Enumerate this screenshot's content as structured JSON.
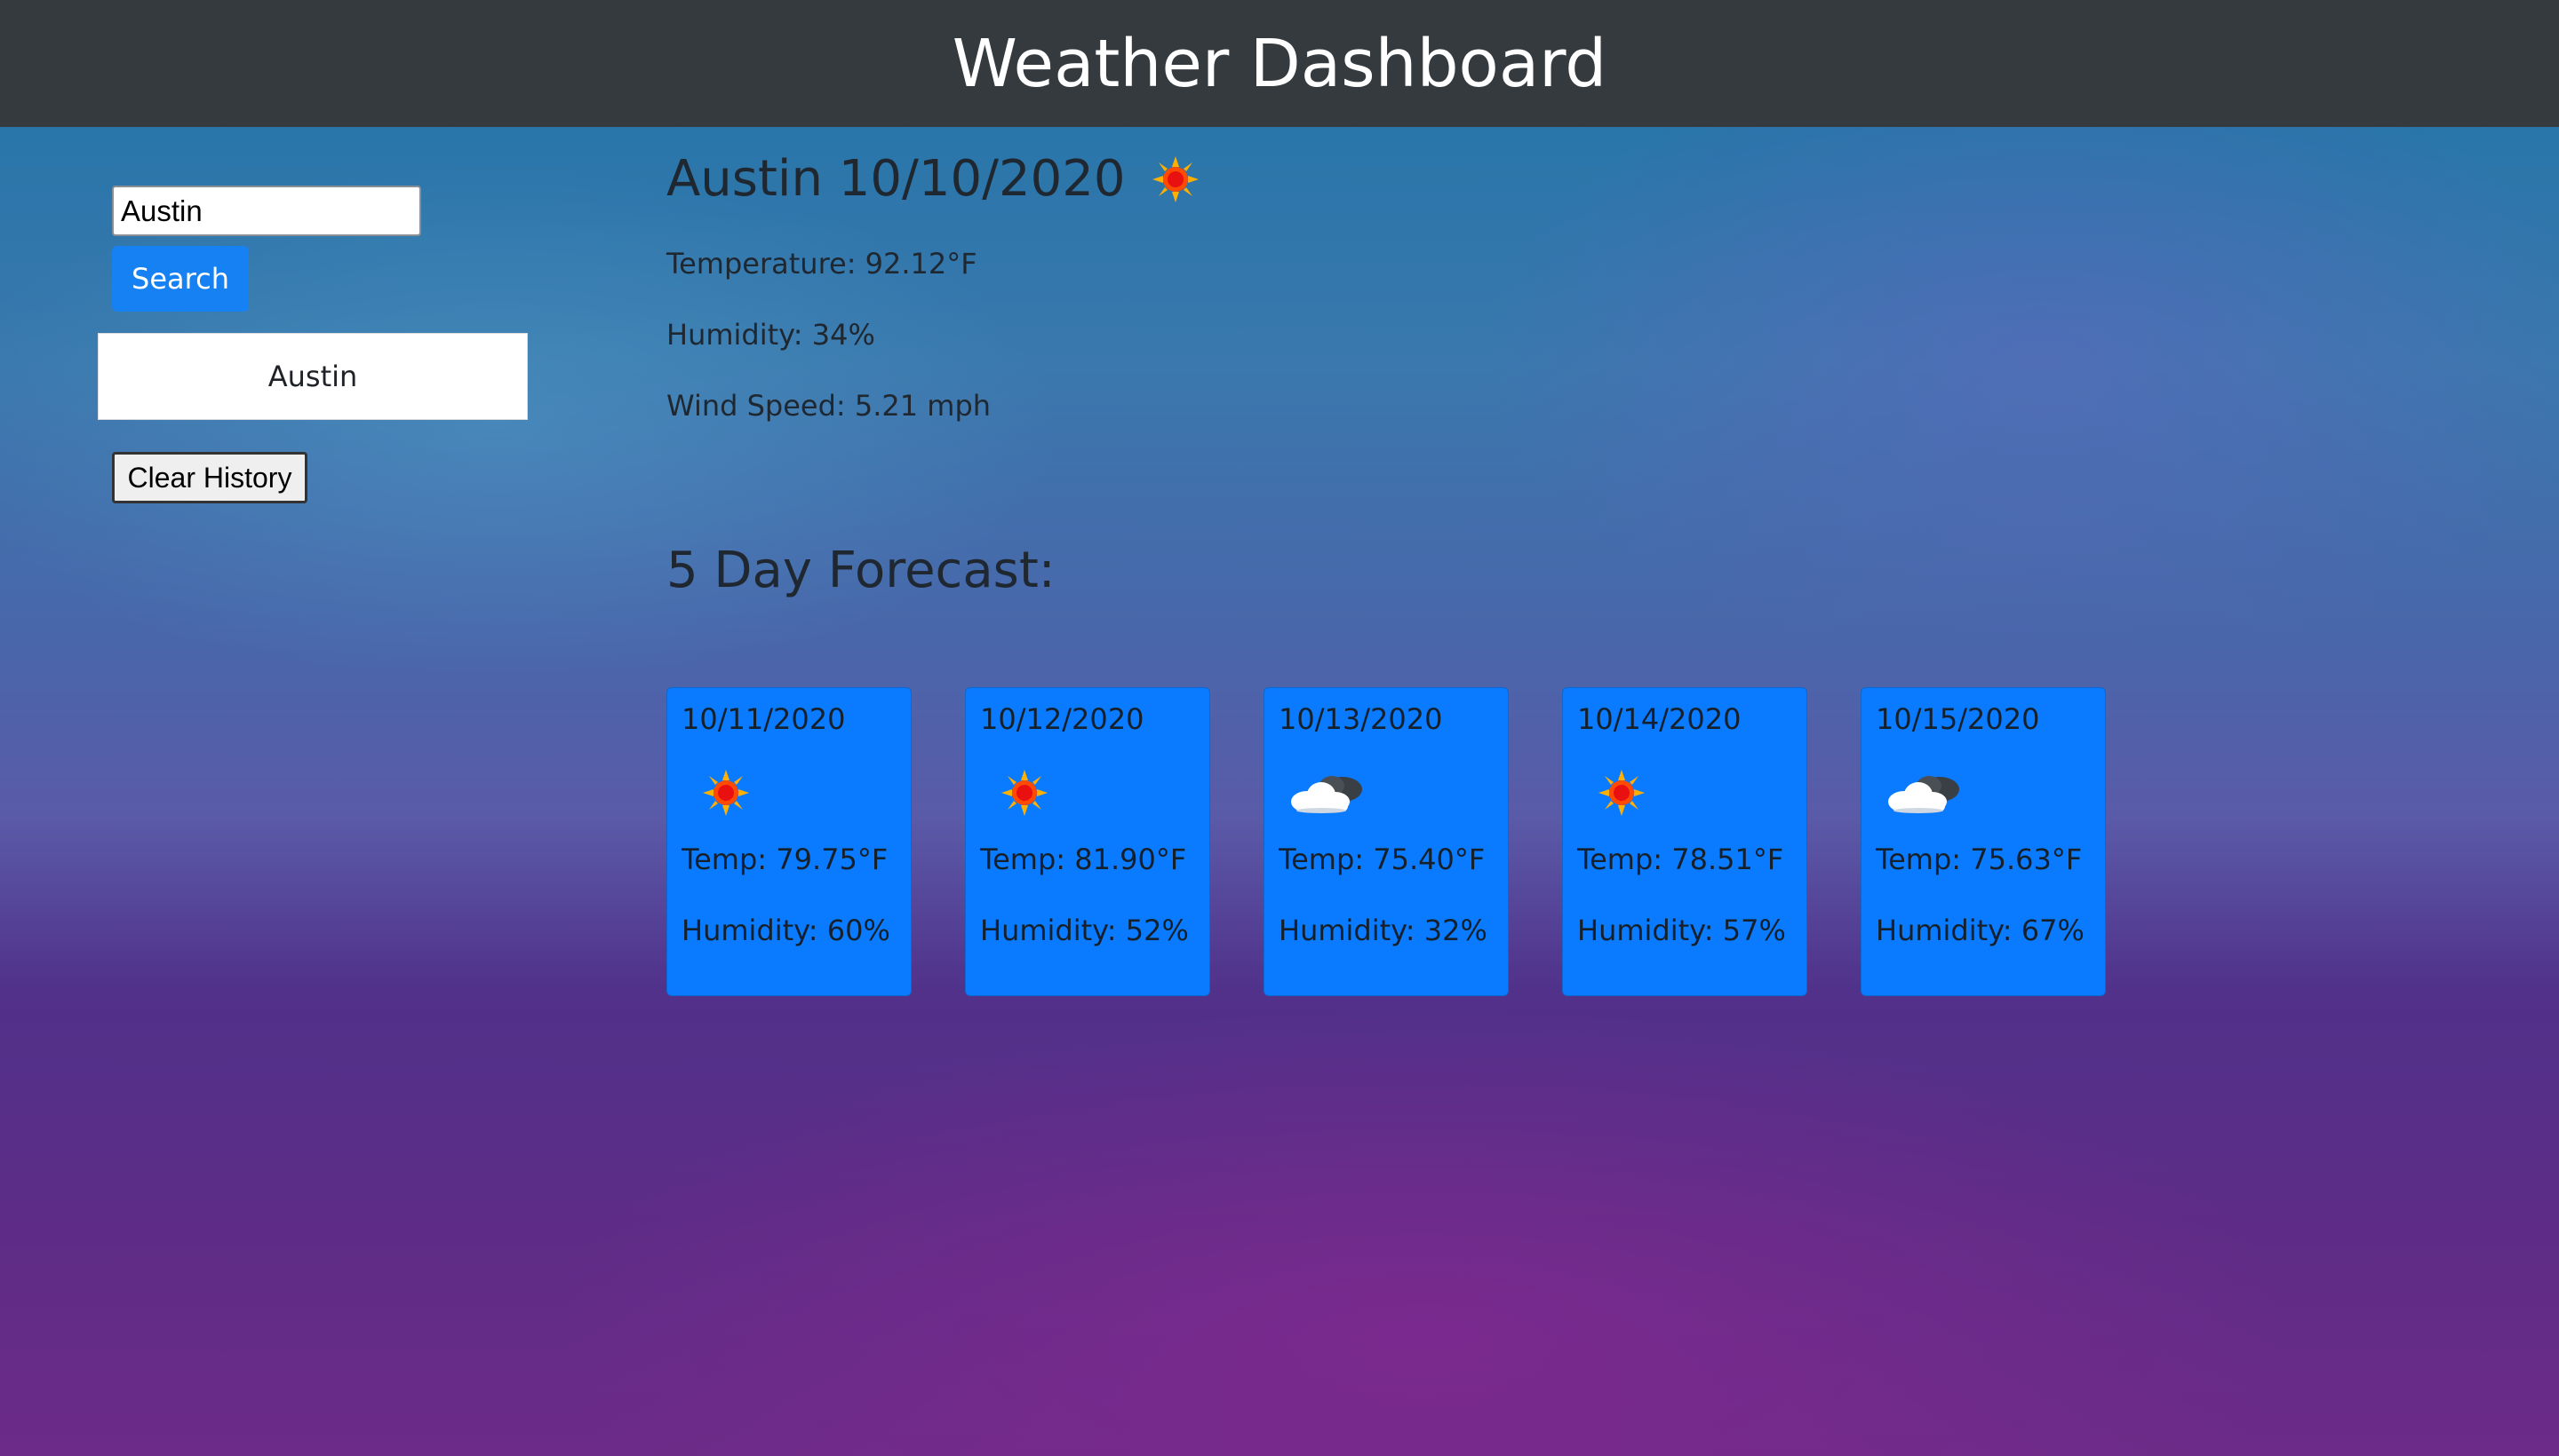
{
  "header": {
    "title": "Weather Dashboard"
  },
  "sidebar": {
    "search": {
      "value": "Austin"
    },
    "search_button_label": "Search",
    "history": [
      {
        "label": "Austin"
      }
    ],
    "clear_button_label": "Clear History"
  },
  "current": {
    "title": "Austin 10/10/2020",
    "icon": "sun-icon",
    "temperature": "Temperature: 92.12°F",
    "humidity": "Humidity: 34%",
    "wind": "Wind Speed: 5.21 mph"
  },
  "forecast": {
    "title": "5 Day Forecast:",
    "days": [
      {
        "date": "10/11/2020",
        "icon": "sun-icon",
        "temp": "Temp: 79.75°F",
        "humidity": "Humidity: 60%"
      },
      {
        "date": "10/12/2020",
        "icon": "sun-icon",
        "temp": "Temp: 81.90°F",
        "humidity": "Humidity: 52%"
      },
      {
        "date": "10/13/2020",
        "icon": "cloud-icon",
        "temp": "Temp: 75.40°F",
        "humidity": "Humidity: 32%"
      },
      {
        "date": "10/14/2020",
        "icon": "sun-icon",
        "temp": "Temp: 78.51°F",
        "humidity": "Humidity: 57%"
      },
      {
        "date": "10/15/2020",
        "icon": "cloud-icon",
        "temp": "Temp: 75.63°F",
        "humidity": "Humidity: 67%"
      }
    ]
  },
  "colors": {
    "header_bg": "#343a3e",
    "accent_blue": "#1681f2",
    "card_blue": "#0a7bff"
  }
}
